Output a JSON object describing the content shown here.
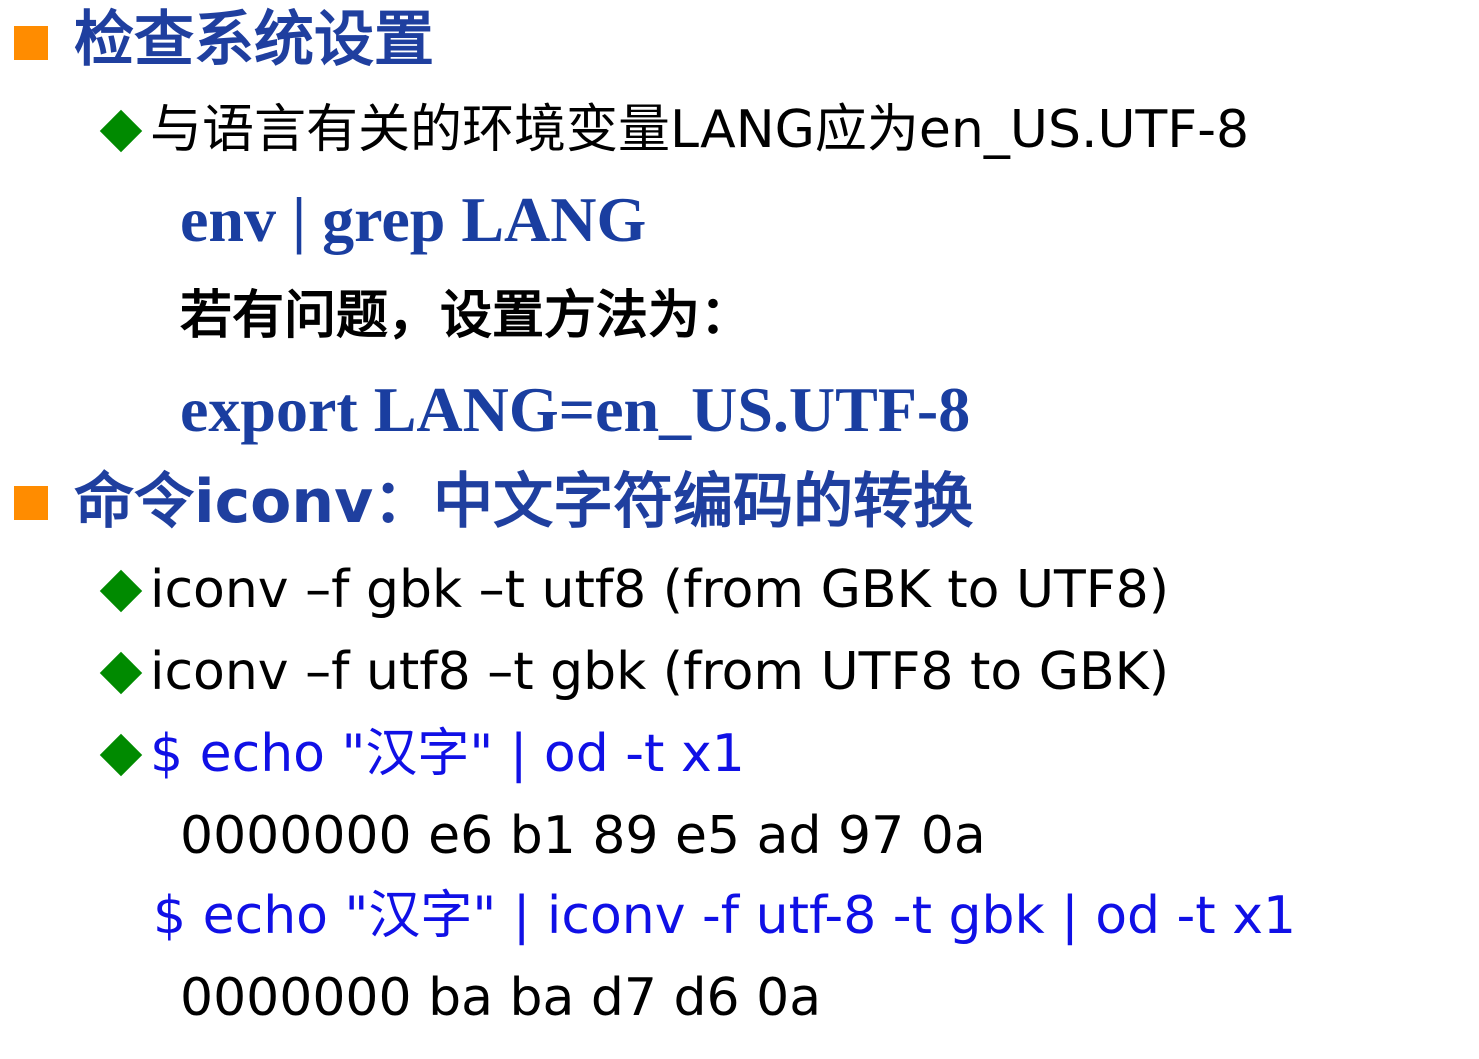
{
  "colors": {
    "heading": "#1f3f9f",
    "command": "#1a3ea0",
    "body": "#000000",
    "terminal": "#1010e6",
    "square_bullet": "#ff8c00",
    "diamond_bullet": "#008a00"
  },
  "section1": {
    "title": "检查系统设置",
    "bullet": "与语言有关的环境变量LANG应为en_US.UTF-8",
    "cmd1": "env | grep LANG",
    "note": "若有问题，设置方法为：",
    "cmd2": "export LANG=en_US.UTF-8"
  },
  "section2": {
    "title": "命令iconv：中文字符编码的转换",
    "bullet1": "iconv –f gbk –t utf8 (from GBK to UTF8)",
    "bullet2": "iconv –f utf8 –t gbk (from UTF8 to GBK)",
    "bullet3": "$ echo \"汉字\" | od -t x1",
    "output1": "0000000 e6 b1 89 e5 ad 97 0a",
    "cmd": "$ echo \"汉字\" | iconv -f utf-8 -t gbk | od -t x1",
    "output2": "0000000 ba ba d7 d6 0a"
  }
}
